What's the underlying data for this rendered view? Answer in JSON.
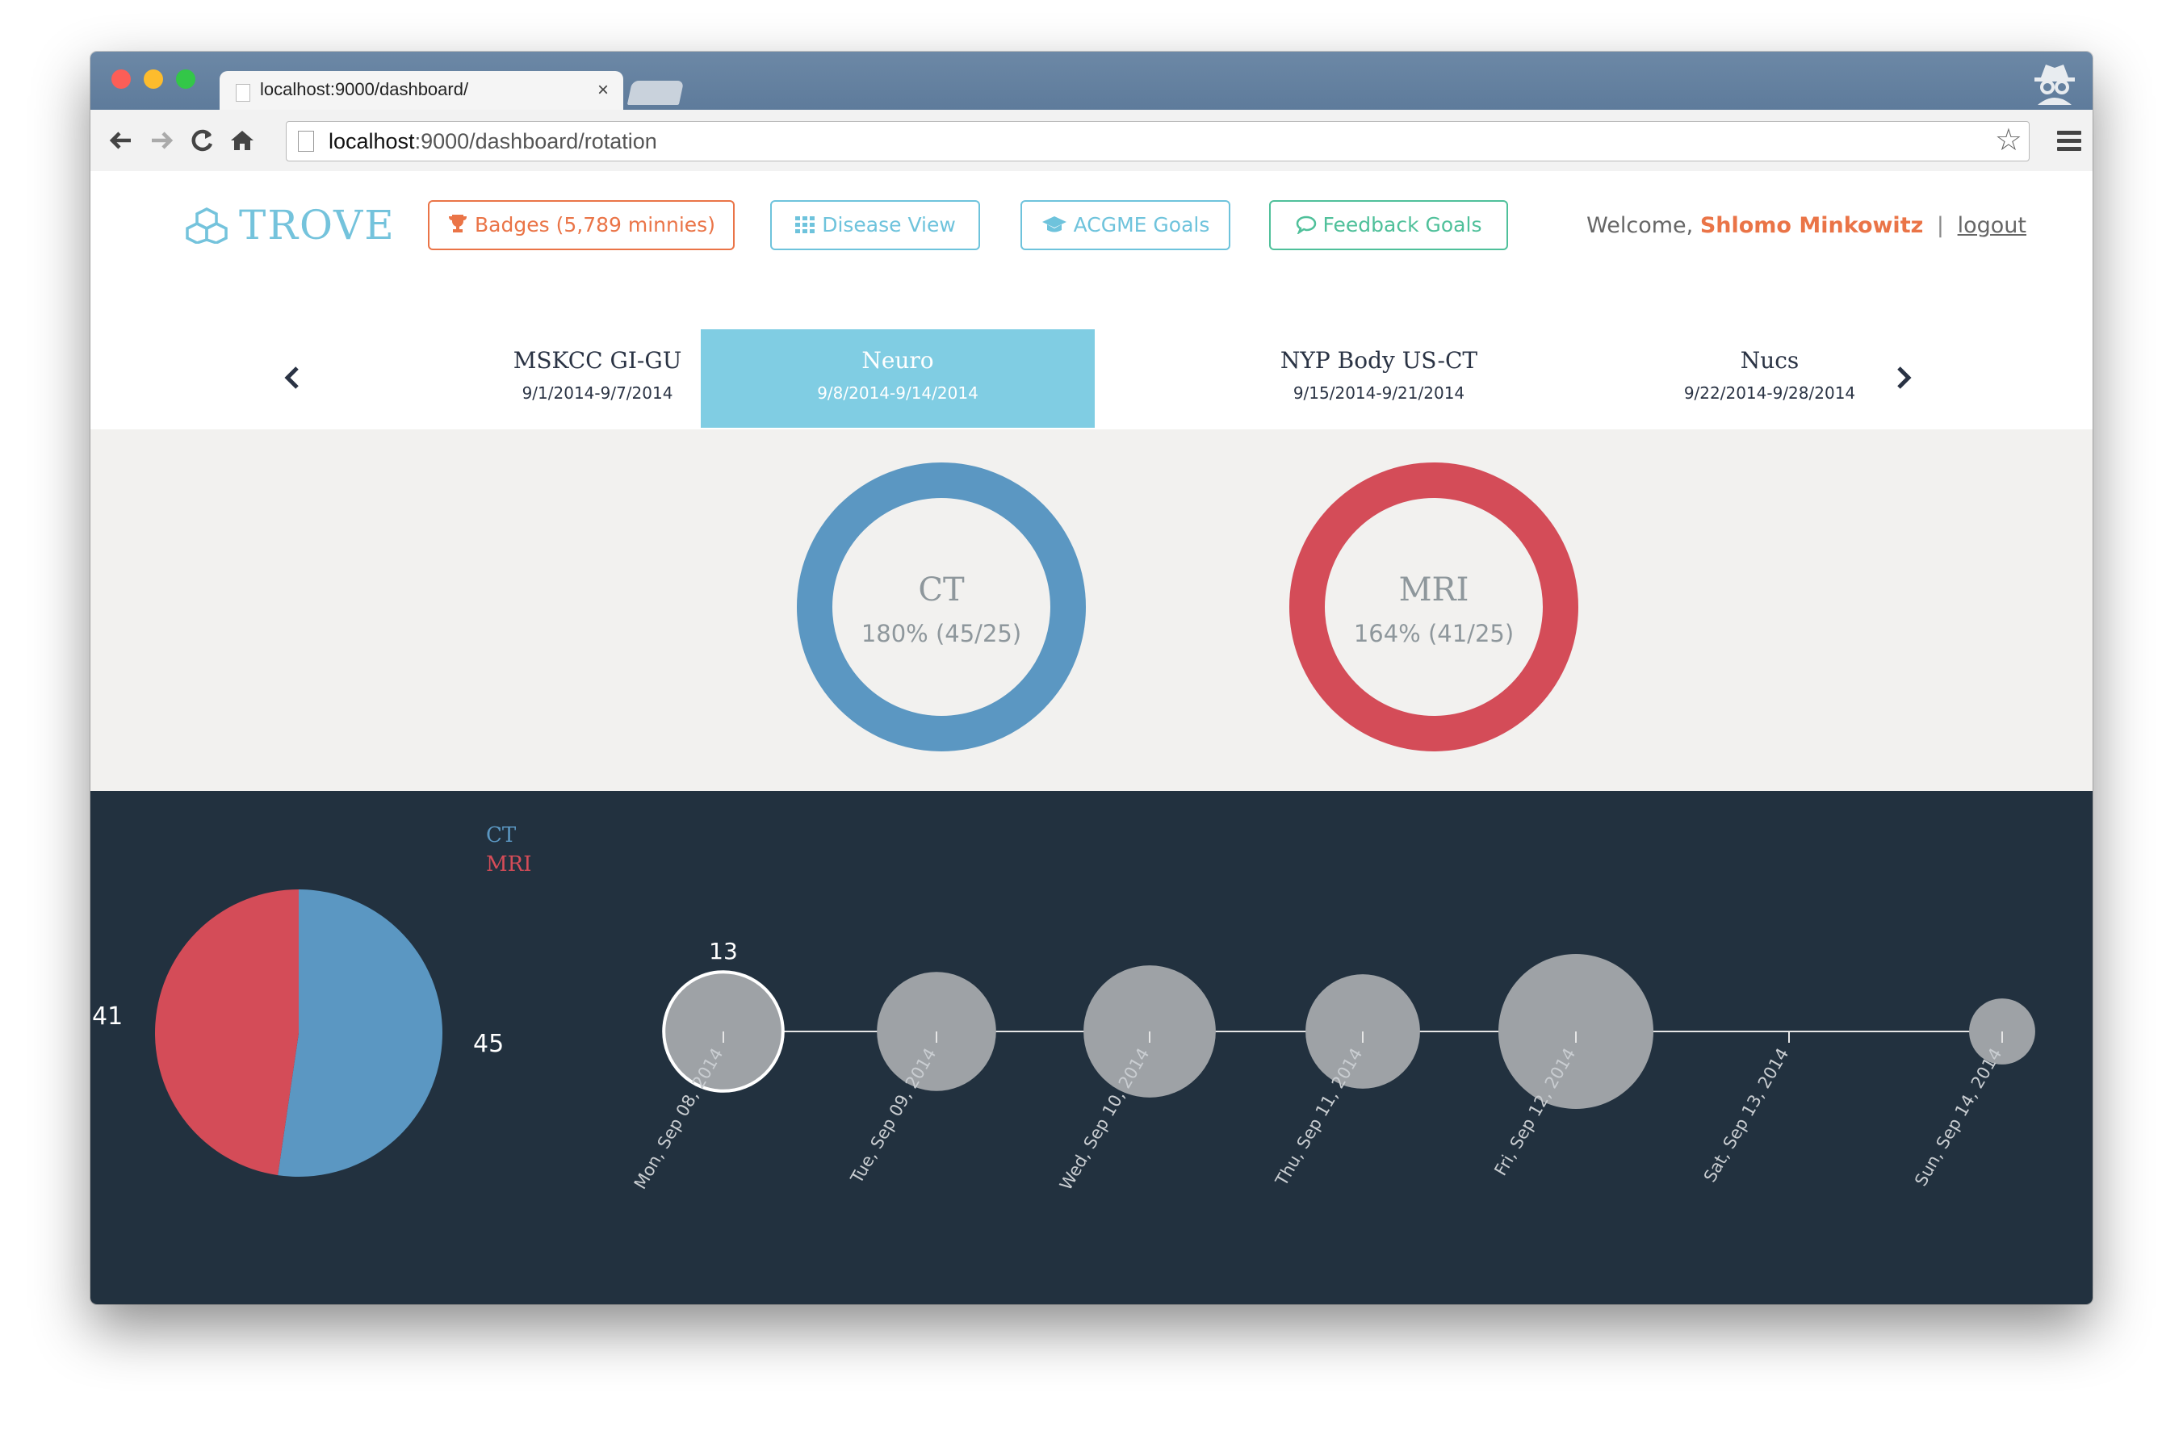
{
  "browser": {
    "tab_title": "localhost:9000/dashboard/",
    "tab_close": "×",
    "url_host": "localhost",
    "url_rest": ":9000/dashboard/rotation",
    "star": "☆"
  },
  "header": {
    "logo_text": "TROVE",
    "nav": {
      "badges": "Badges (5,789 minnies)",
      "disease": "Disease View",
      "acgme": "ACGME Goals",
      "feedback": "Feedback Goals"
    },
    "welcome_prefix": "Welcome,",
    "user_name": "Shlomo Minkowitz",
    "separator": "|",
    "logout": "logout"
  },
  "rotations": [
    {
      "name": "MSKCC GI-GU",
      "dates": "9/1/2014-9/7/2014",
      "active": false
    },
    {
      "name": "Neuro",
      "dates": "9/8/2014-9/14/2014",
      "active": true
    },
    {
      "name": "NYP Body US-CT",
      "dates": "9/15/2014-9/21/2014",
      "active": false
    },
    {
      "name": "Nucs",
      "dates": "9/22/2014-9/28/2014",
      "active": false
    }
  ],
  "goals": [
    {
      "name": "CT",
      "progress": "180% (45/25)",
      "color": "#5b97c2",
      "fraction": 1.0
    },
    {
      "name": "MRI",
      "progress": "164% (41/25)",
      "color": "#d44c58",
      "fraction": 1.0
    }
  ],
  "colors": {
    "ct": "#5b97c2",
    "mri": "#d44c58",
    "dark_bg": "#22313f",
    "light_bg": "#f2f1ef",
    "accent": "#74c3dc",
    "orange": "#ea7447",
    "green": "#4fc09a"
  },
  "chart_data": [
    {
      "type": "pie",
      "legend": [
        "CT",
        "MRI"
      ],
      "legend_placement": "top-right",
      "series": [
        {
          "name": "CT",
          "value": 45,
          "color": "#5b97c2"
        },
        {
          "name": "MRI",
          "value": 41,
          "color": "#d44c58"
        }
      ]
    },
    {
      "type": "scatter",
      "x": [
        "Mon, Sep 08, 2014",
        "Tue, Sep 09, 2014",
        "Wed, Sep 10, 2014",
        "Thu, Sep 11, 2014",
        "Fri, Sep 12, 2014",
        "Sat, Sep 13, 2014",
        "Sun, Sep 14, 2014"
      ],
      "sizes": [
        13,
        13,
        16,
        12,
        22,
        0,
        4
      ],
      "highlighted_label": "13",
      "highlighted_index": 0
    }
  ]
}
